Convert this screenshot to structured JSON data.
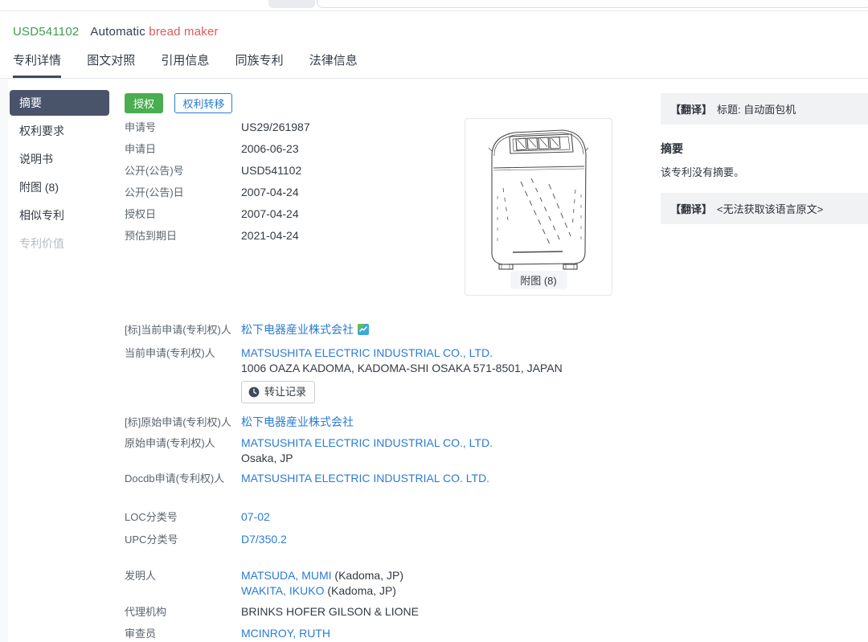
{
  "header": {
    "patent_number": "USD541102",
    "title_plain": "Automatic",
    "title_highlight": "bread maker"
  },
  "tabs": {
    "items": [
      {
        "label": "专利详情",
        "active": true
      },
      {
        "label": "图文对照",
        "active": false
      },
      {
        "label": "引用信息",
        "active": false
      },
      {
        "label": "同族专利",
        "active": false
      },
      {
        "label": "法律信息",
        "active": false
      }
    ]
  },
  "sidebar": {
    "items": [
      {
        "label": "摘要",
        "state": "active"
      },
      {
        "label": "权利要求",
        "state": "normal"
      },
      {
        "label": "说明书",
        "state": "normal"
      },
      {
        "label": "附图 (8)",
        "state": "normal"
      },
      {
        "label": "相似专利",
        "state": "normal"
      },
      {
        "label": "专利价值",
        "state": "disabled"
      }
    ]
  },
  "badges": {
    "granted": "授权",
    "rights_transfer": "权利转移"
  },
  "bibliographic": {
    "rows": [
      {
        "label": "申请号",
        "value": "US29/261987"
      },
      {
        "label": "申请日",
        "value": "2006-06-23"
      },
      {
        "label": "公开(公告)号",
        "value": "USD541102"
      },
      {
        "label": "公开(公告)日",
        "value": "2007-04-24"
      },
      {
        "label": "授权日",
        "value": "2007-04-24"
      },
      {
        "label": "预估到期日",
        "value": "2021-04-24"
      }
    ]
  },
  "figure": {
    "caption": "附图 (8)"
  },
  "translation_panel": {
    "title_box": {
      "prefix": "【翻译】",
      "text": "标题: 自动面包机"
    },
    "abstract_heading": "摘要",
    "abstract_text": "该专利没有摘要。",
    "original_box": {
      "prefix": "【翻译】",
      "text": "<无法获取该语言原文>"
    }
  },
  "details": {
    "current_std": {
      "label": "[标]当前申请(专利权)人",
      "value": "松下电器産业株式会社"
    },
    "current": {
      "label": "当前申请(专利权)人",
      "name": "MATSUSHITA ELECTRIC INDUSTRIAL CO., LTD.",
      "address": "1006 OAZA KADOMA, KADOMA-SHI OSAKA 571-8501, JAPAN"
    },
    "transfer_button_label": "转让记录",
    "original_std": {
      "label": "[标]原始申请(专利权)人",
      "value": "松下电器産业株式会社"
    },
    "original": {
      "label": "原始申请(专利权)人",
      "name": "MATSUSHITA ELECTRIC INDUSTRIAL CO., LTD.",
      "address": "Osaka, JP"
    },
    "docdb": {
      "label": "Docdb申请(专利权)人",
      "value": "MATSUSHITA ELECTRIC INDUSTRIAL CO. LTD."
    },
    "loc": {
      "label": "LOC分类号",
      "value": "07-02"
    },
    "upc": {
      "label": "UPC分类号",
      "value": "D7/350.2"
    },
    "inventors": {
      "label": "发明人",
      "items": [
        {
          "name": "MATSUDA, MUMI",
          "location": " (Kadoma, JP)"
        },
        {
          "name": "WAKITA, IKUKO",
          "location": " (Kadoma, JP)"
        }
      ]
    },
    "agency": {
      "label": "代理机构",
      "value": "BRINKS HOFER GILSON & LIONE"
    },
    "examiner": {
      "label": "审查员",
      "value": "MCINROY, RUTH"
    }
  },
  "colors": {
    "link_blue": "#2b7bd3",
    "granted_green": "#4aad52",
    "patent_number_green": "#3c9e4d",
    "highlight_red": "#dd5a57",
    "active_slate": "#49546b",
    "panel_gray": "#f1f2f4"
  }
}
